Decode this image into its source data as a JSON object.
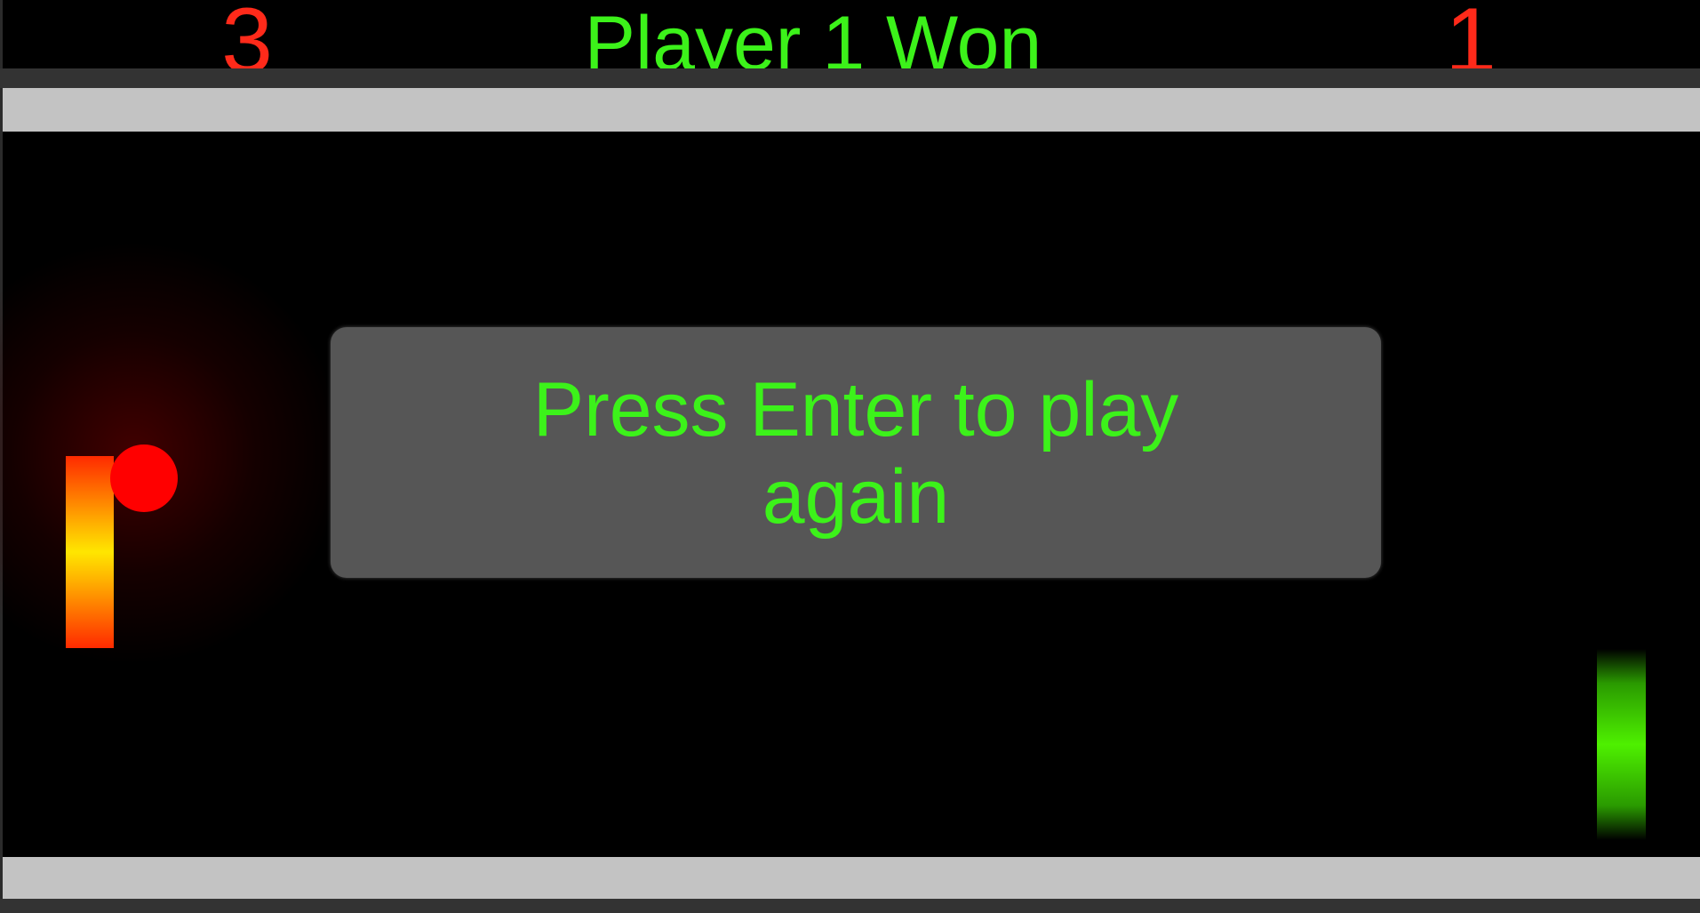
{
  "colors": {
    "score": "#ff2a1a",
    "status": "#3cf21a",
    "prompt": "#3cf21a",
    "left_paddle": "#ffb000",
    "right_paddle": "#4ef000",
    "ball": "#ff0000",
    "wall": "#c3c3c3",
    "dialog_bg": "#565656"
  },
  "scoreboard": {
    "left_score": "3",
    "right_score": "1",
    "status": "Player 1 Won"
  },
  "dialog": {
    "line1": "Press Enter to play",
    "line2": "again"
  }
}
